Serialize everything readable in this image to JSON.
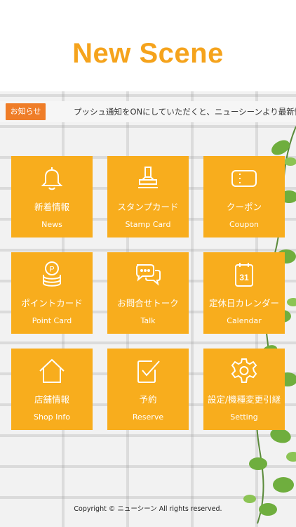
{
  "app": {
    "title": "New Scene"
  },
  "colors": {
    "accent": "#f5a31c",
    "tile": "#f8ad1d",
    "notice_label": "#ef7d28"
  },
  "notice": {
    "label": "お知らせ",
    "text": "プッシュ通知をONにしていただくと、ニューシーンより最新情報を"
  },
  "menu": {
    "items": [
      {
        "jp": "新着情報",
        "en": "News",
        "icon": "bell-icon"
      },
      {
        "jp": "スタンプカード",
        "en": "Stamp Card",
        "icon": "stamp-icon"
      },
      {
        "jp": "クーポン",
        "en": "Coupon",
        "icon": "ticket-icon"
      },
      {
        "jp": "ポイントカード",
        "en": "Point Card",
        "icon": "coins-icon"
      },
      {
        "jp": "お問合せトーク",
        "en": "Talk",
        "icon": "chat-icon"
      },
      {
        "jp": "定休日カレンダー",
        "en": "Calendar",
        "icon": "calendar-icon"
      },
      {
        "jp": "店舗情報",
        "en": "Shop Info",
        "icon": "house-icon"
      },
      {
        "jp": "予約",
        "en": "Reserve",
        "icon": "checkbox-icon"
      },
      {
        "jp": "設定/機種変更引継",
        "en": "Setting",
        "icon": "gear-icon"
      }
    ]
  },
  "calendar_icon_day": "31",
  "point_icon_letter": "P",
  "footer": {
    "copyright": "Copyright © ニューシーン All rights reserved."
  }
}
